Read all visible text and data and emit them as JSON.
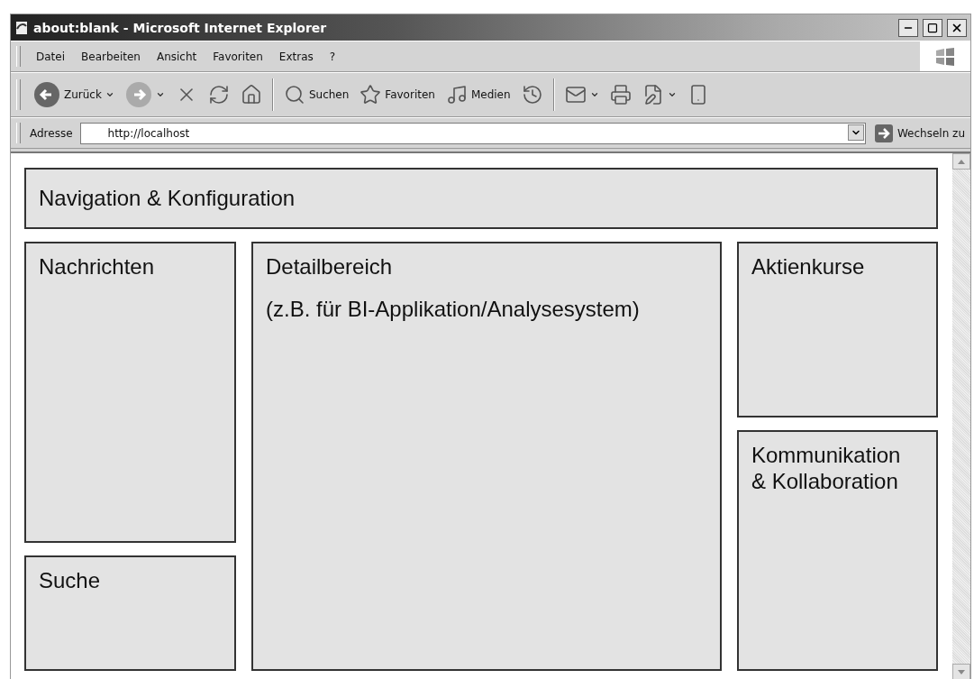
{
  "window": {
    "title": "about:blank - Microsoft Internet Explorer"
  },
  "menu": [
    "Datei",
    "Bearbeiten",
    "Ansicht",
    "Favoriten",
    "Extras",
    "?"
  ],
  "toolbar": [
    {
      "kind": "back",
      "label": "Zurück",
      "dropdown": true
    },
    {
      "kind": "forward",
      "dropdown": true
    },
    {
      "kind": "stop"
    },
    {
      "kind": "refresh"
    },
    {
      "kind": "home"
    },
    {
      "kind": "separator"
    },
    {
      "kind": "search",
      "label": "Suchen"
    },
    {
      "kind": "favorites",
      "label": "Favoriten"
    },
    {
      "kind": "media",
      "label": "Medien"
    },
    {
      "kind": "history"
    },
    {
      "kind": "separator"
    },
    {
      "kind": "mail",
      "dropdown": true
    },
    {
      "kind": "print"
    },
    {
      "kind": "edit",
      "dropdown": true
    },
    {
      "kind": "messenger"
    }
  ],
  "address": {
    "label": "Adresse",
    "value": "http://localhost",
    "go": "Wechseln zu"
  },
  "panels": [
    {
      "kind": "nav",
      "lines": [
        "Navigation & Konfiguration"
      ]
    },
    {
      "kind": "news",
      "lines": [
        "Nachrichten"
      ]
    },
    {
      "kind": "search",
      "lines": [
        "Suche"
      ]
    },
    {
      "kind": "detail",
      "lines": [
        "Detailbereich",
        "(z.B. für BI-Applikation/Analysesystem)"
      ]
    },
    {
      "kind": "stocks",
      "lines": [
        "Aktienkurse"
      ]
    },
    {
      "kind": "collab",
      "lines": [
        "Kommunikation",
        "& Kollaboration"
      ]
    }
  ]
}
